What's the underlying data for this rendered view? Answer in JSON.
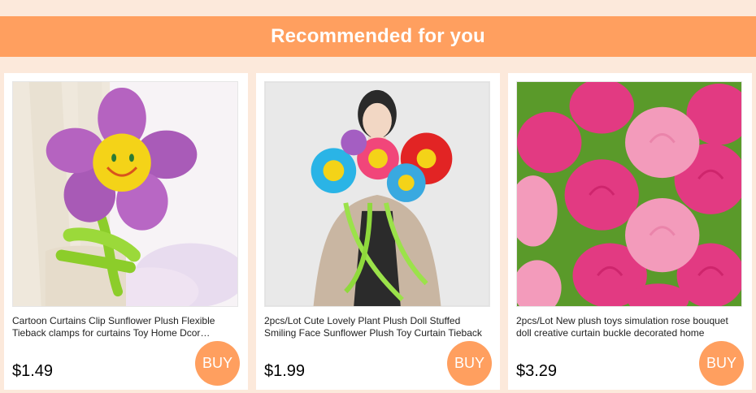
{
  "header": {
    "title": "Recommended for you"
  },
  "products": [
    {
      "title": "Cartoon Curtains Clip Sunflower Plush Flexible Tieback clamps for curtains Toy Home Dcor Accessory",
      "price": "$1.49",
      "buy_label": "BUY"
    },
    {
      "title": "2pcs/Lot Cute Lovely Plant Plush Doll Stuffed Smiling Face Sunflower Plush Toy Curtain Tieback",
      "price": "$1.99",
      "buy_label": "BUY"
    },
    {
      "title": "2pcs/Lot New plush toys simulation rose bouquet doll creative curtain buckle decorated home",
      "price": "$3.29",
      "buy_label": "BUY"
    }
  ],
  "colors": {
    "accent": "#ff9f5f",
    "page_bg": "#fce9db"
  }
}
